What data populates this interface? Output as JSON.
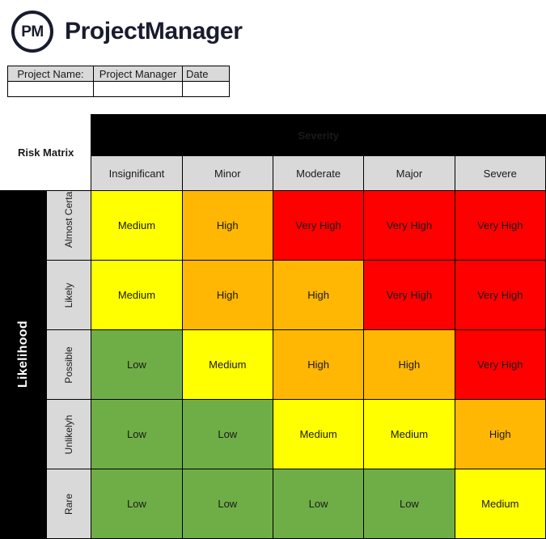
{
  "brand": {
    "logo_text": "PM",
    "name": "ProjectManager"
  },
  "project_info": {
    "headers": [
      "Project Name:",
      "Project Manager",
      "Date"
    ],
    "values": [
      "",
      "",
      ""
    ]
  },
  "matrix": {
    "corner_label": "Risk Matrix",
    "severity_axis_label": "Severity",
    "likelihood_axis_label": "Likelihood",
    "severity_levels": [
      "Insignificant",
      "Minor",
      "Moderate",
      "Major",
      "Severe"
    ],
    "likelihood_levels": [
      "Almost Certain",
      "Likely",
      "Possible",
      "Unlikelyh",
      "Rare"
    ],
    "level_colors": {
      "Low": "#6FAE46",
      "Medium": "#FFFF00",
      "High": "#FFB703",
      "Very High": "#FF0000"
    },
    "cells": [
      [
        "Medium",
        "High",
        "Very High",
        "Very High",
        "Very High"
      ],
      [
        "Medium",
        "High",
        "High",
        "Very High",
        "Very High"
      ],
      [
        "Low",
        "Medium",
        "High",
        "High",
        "Very High"
      ],
      [
        "Low",
        "Low",
        "Medium",
        "Medium",
        "High"
      ],
      [
        "Low",
        "Low",
        "Low",
        "Low",
        "Medium"
      ]
    ]
  }
}
